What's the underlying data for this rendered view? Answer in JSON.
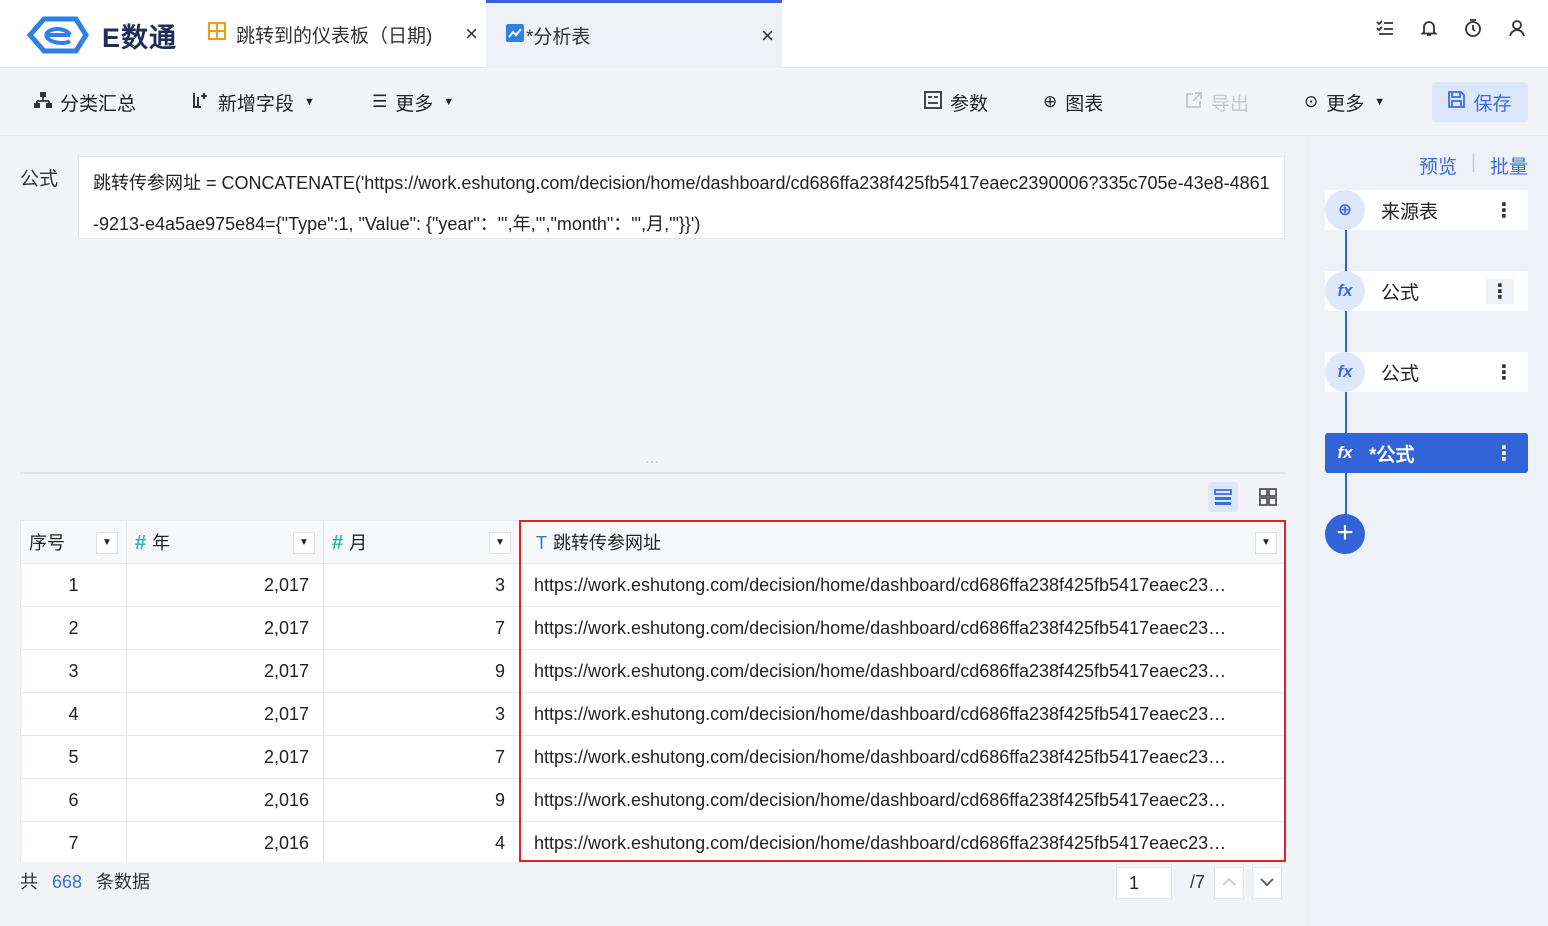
{
  "app": {
    "logo_text": "E数通",
    "tabs": [
      {
        "label": "跳转到的仪表板（日期)",
        "icon": "dashboard-icon"
      },
      {
        "label": "*分析表",
        "icon": "analysis-icon"
      }
    ],
    "close_symbol": "×",
    "top_icons": [
      "task-list-icon",
      "bell-icon",
      "timer-icon",
      "user-icon"
    ]
  },
  "toolbar": {
    "group_label": "分类汇总",
    "add_field_label": "新增字段",
    "more_left_label": "更多",
    "params_label": "参数",
    "chart_label": "图表",
    "export_label": "导出",
    "more_right_label": "更多",
    "save_label": "保存"
  },
  "formula": {
    "label": "公式",
    "text": "跳转传参网址 = CONCATENATE('https://work.eshutong.com/decision/home/dashboard/cd686ffa238f425fb5417eaec2390006?335c705e-43e8-4861-9213-e4a5ae975e84={\"Type\":1, \"Value\": {\"year\"：\"',年,'\",\"month\"：\"',月,'\"}}')"
  },
  "table": {
    "columns": [
      {
        "label": "序号",
        "type": "index"
      },
      {
        "label": "年",
        "type": "number"
      },
      {
        "label": "月",
        "type": "number"
      },
      {
        "label": "跳转传参网址",
        "type": "text"
      }
    ],
    "rows": [
      {
        "idx": "1",
        "year": "2,017",
        "month": "3",
        "url": "https://work.eshutong.com/decision/home/dashboard/cd686ffa238f425fb5417eaec23…"
      },
      {
        "idx": "2",
        "year": "2,017",
        "month": "7",
        "url": "https://work.eshutong.com/decision/home/dashboard/cd686ffa238f425fb5417eaec23…"
      },
      {
        "idx": "3",
        "year": "2,017",
        "month": "9",
        "url": "https://work.eshutong.com/decision/home/dashboard/cd686ffa238f425fb5417eaec23…"
      },
      {
        "idx": "4",
        "year": "2,017",
        "month": "3",
        "url": "https://work.eshutong.com/decision/home/dashboard/cd686ffa238f425fb5417eaec23…"
      },
      {
        "idx": "5",
        "year": "2,017",
        "month": "7",
        "url": "https://work.eshutong.com/decision/home/dashboard/cd686ffa238f425fb5417eaec23…"
      },
      {
        "idx": "6",
        "year": "2,016",
        "month": "9",
        "url": "https://work.eshutong.com/decision/home/dashboard/cd686ffa238f425fb5417eaec23…"
      },
      {
        "idx": "7",
        "year": "2,016",
        "month": "4",
        "url": "https://work.eshutong.com/decision/home/dashboard/cd686ffa238f425fb5417eaec23…"
      }
    ]
  },
  "footer": {
    "prefix": "共",
    "count": "668",
    "suffix": "条数据",
    "page": "1",
    "total_pages": "/7"
  },
  "side": {
    "preview_label": "预览",
    "batch_label": "批量",
    "nodes": [
      {
        "label": "来源表",
        "icon": "source-icon"
      },
      {
        "label": "公式",
        "icon": "fx-icon"
      },
      {
        "label": "公式",
        "icon": "fx-icon"
      },
      {
        "label": "*公式",
        "icon": "fx-icon",
        "active": true
      }
    ],
    "add_symbol": "+"
  },
  "colors": {
    "accent": "#3264d8",
    "highlight_border": "#e02424",
    "number_icon": "#2fb8a4"
  }
}
